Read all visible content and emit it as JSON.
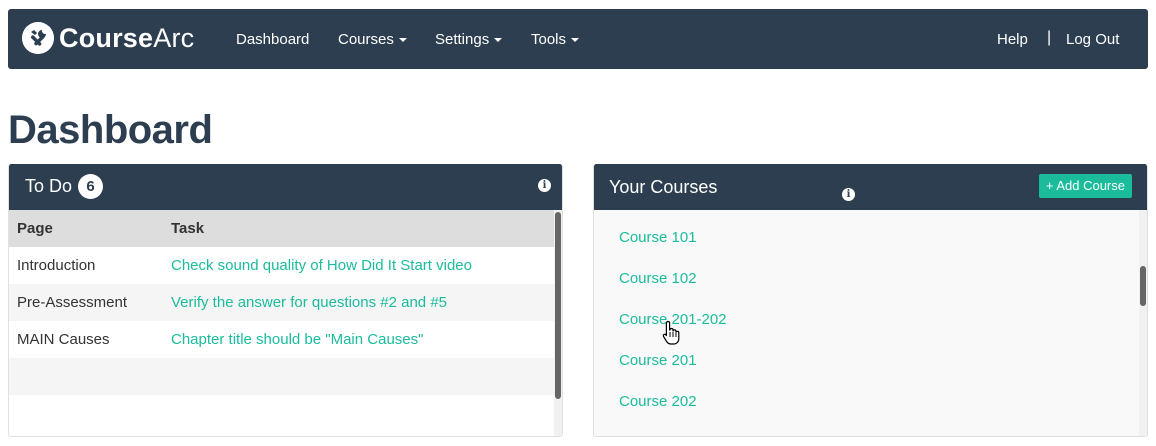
{
  "brand": {
    "name_bold": "Course",
    "name_regular": "Arc"
  },
  "nav": {
    "dashboard": "Dashboard",
    "courses": "Courses",
    "settings": "Settings",
    "tools": "Tools",
    "help": "Help",
    "separator": "|",
    "logout": "Log Out"
  },
  "page": {
    "title": "Dashboard"
  },
  "todo": {
    "title": "To Do",
    "count": "6",
    "info": "i",
    "columns": [
      "Page",
      "Task"
    ],
    "rows": [
      {
        "page": "Introduction",
        "task": "Check sound quality of How Did It Start video"
      },
      {
        "page": "Pre-Assessment",
        "task": "Verify the answer for questions #2 and #5"
      },
      {
        "page": "MAIN Causes",
        "task": "Chapter title should be \"Main Causes\""
      }
    ]
  },
  "courses": {
    "title": "Your Courses",
    "info": "i",
    "add_label": "+ Add Course",
    "items": [
      "Course 101",
      "Course 102",
      "Course 201-202",
      "Course 201",
      "Course 202"
    ]
  },
  "colors": {
    "navbar": "#2c3e50",
    "accent": "#1abc9c",
    "title": "#2c3e50"
  }
}
